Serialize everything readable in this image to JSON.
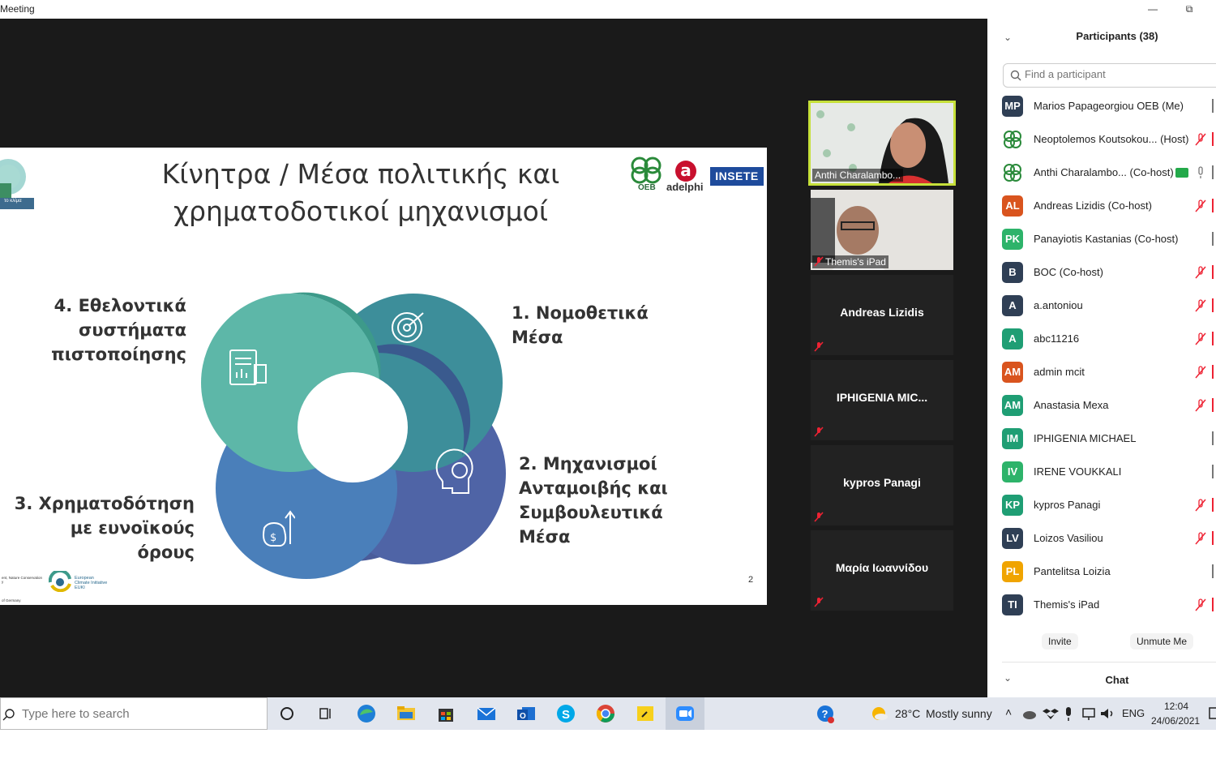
{
  "window": {
    "title": "Meeting",
    "restore_icon": "restore-icon",
    "minimize_icon": "minimize-icon"
  },
  "slide": {
    "title_line1": "Κίνητρα / Μέσα πολιτικής και",
    "title_line2": "χρηματοδοτικοί μηχανισμοί",
    "label1_line1": "1. Νομοθετικά",
    "label1_line2": "Μέσα",
    "label2_line1": "2. Μηχανισμοί",
    "label2_line2": "Ανταμοιβής και",
    "label2_line3": "Συμβουλευτικά",
    "label2_line4": "Μέσα",
    "label3_line1": "3. Χρηματοδότηση",
    "label3_line2": "με ευνοϊκούς όρους",
    "label4_line1": "4. Εθελοντικά",
    "label4_line2": "συστήματα",
    "label4_line3": "πιστοποίησης",
    "page_number": "2",
    "logo_oeb": "OEB",
    "logo_adelphi": "adelphi",
    "logo_adelphi_mark": "a",
    "logo_insete": "INSETE",
    "logo_topleft_text": "το κλίμα",
    "euki_line1": "European",
    "euki_line2": "Climate Initiative",
    "euki_line3": "EUKI",
    "bmu_line1": "ent, Nature Conservation",
    "bmu_line2": "y",
    "bmu_line3": "of Germany",
    "colors": {
      "green": "#4fa88f",
      "teal": "#3d8e9a",
      "blue": "#4a73b0",
      "navy": "#3a4f8e"
    }
  },
  "videos": [
    {
      "name": "Anthi Charalambo...",
      "type": "camera",
      "active": true
    },
    {
      "name": "Themis's iPad",
      "type": "camera",
      "muted": true
    },
    {
      "name": "Andreas Lizidis",
      "type": "name",
      "muted": true
    },
    {
      "name": "IPHIGENIA  MIC...",
      "type": "name",
      "muted": true
    },
    {
      "name": "kypros Panagi",
      "type": "name",
      "muted": true
    },
    {
      "name": "Μαρία Ιωαννίδου",
      "type": "name",
      "muted": true
    }
  ],
  "participants_panel": {
    "title": "Participants (38)",
    "search_placeholder": "Find a participant",
    "invite_label": "Invite",
    "unmute_label": "Unmute Me",
    "chat_title": "Chat",
    "participants": [
      {
        "initials": "MP",
        "name": "Marios Papageorgiou OEB (Me)",
        "color": "#2f3f55",
        "mic": "none"
      },
      {
        "initials": "",
        "name": "Neoptolemos Koutsokou... (Host)",
        "color": "logo",
        "mic": "muted"
      },
      {
        "initials": "",
        "name": "Anthi Charalambo... (Co-host)",
        "color": "logo",
        "mic": "on",
        "share": true
      },
      {
        "initials": "AL",
        "name": "Andreas Lizidis (Co-host)",
        "color": "#d9541e",
        "mic": "muted"
      },
      {
        "initials": "PK",
        "name": "Panayiotis Kastanias (Co-host)",
        "color": "#2db36a",
        "mic": "none"
      },
      {
        "initials": "B",
        "name": "BOC (Co-host)",
        "color": "#2f3f55",
        "mic": "muted"
      },
      {
        "initials": "A",
        "name": "a.antoniou",
        "color": "#2f3f55",
        "mic": "muted"
      },
      {
        "initials": "A",
        "name": "abc11216",
        "color": "#1f9e74",
        "mic": "muted"
      },
      {
        "initials": "AM",
        "name": "admin mcit",
        "color": "#d9541e",
        "mic": "muted"
      },
      {
        "initials": "AM",
        "name": "Anastasia Mexa",
        "color": "#1f9e74",
        "mic": "muted"
      },
      {
        "initials": "IM",
        "name": "IPHIGENIA MICHAEL",
        "color": "#1f9e74",
        "mic": "none"
      },
      {
        "initials": "IV",
        "name": "IRENE VOUKKALI",
        "color": "#2db36a",
        "mic": "none"
      },
      {
        "initials": "KP",
        "name": "kypros Panagi",
        "color": "#1f9e74",
        "mic": "muted"
      },
      {
        "initials": "LV",
        "name": "Loizos Vasiliou",
        "color": "#2f3f55",
        "mic": "muted"
      },
      {
        "initials": "PL",
        "name": "Pantelitsa Loizia",
        "color": "#f0a400",
        "mic": "none"
      },
      {
        "initials": "TI",
        "name": "Themis's iPad",
        "color": "#2f3f55",
        "mic": "muted"
      }
    ]
  },
  "taskbar": {
    "search_placeholder": "Type here to search",
    "weather_temp": "28°C",
    "weather_desc": "Mostly sunny",
    "language": "ENG",
    "time": "12:04",
    "date": "24/06/2021",
    "apps": [
      "task-view-icon",
      "edge-icon",
      "file-explorer-icon",
      "store-icon",
      "mail-icon",
      "outlook-icon",
      "skype-icon",
      "chrome-icon",
      "sticky-notes-icon",
      "zoom-icon"
    ]
  }
}
